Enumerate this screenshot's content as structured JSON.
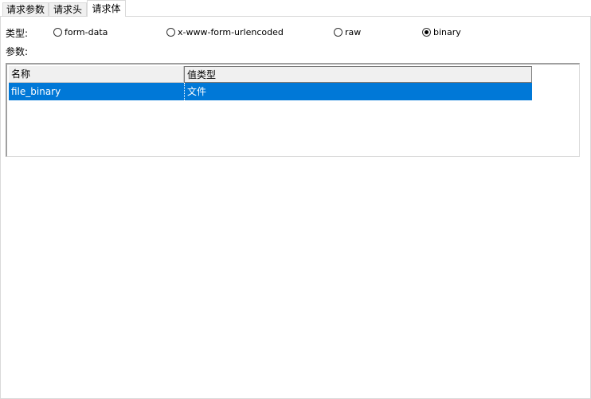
{
  "tabs": [
    {
      "label": "请求参数"
    },
    {
      "label": "请求头"
    },
    {
      "label": "请求体",
      "active": true
    }
  ],
  "body": {
    "type_label": "类型:",
    "params_label": "参数:",
    "types": [
      {
        "label": "form-data",
        "checked": false
      },
      {
        "label": "x-www-form-urlencoded",
        "checked": false
      },
      {
        "label": "raw",
        "checked": false
      },
      {
        "label": "binary",
        "checked": true
      }
    ]
  },
  "grid": {
    "columns": [
      "名称",
      "值类型"
    ],
    "rows": [
      {
        "name": "file_binary",
        "value_type": "文件",
        "selected": true
      }
    ],
    "selection_color": "#0078d7"
  }
}
